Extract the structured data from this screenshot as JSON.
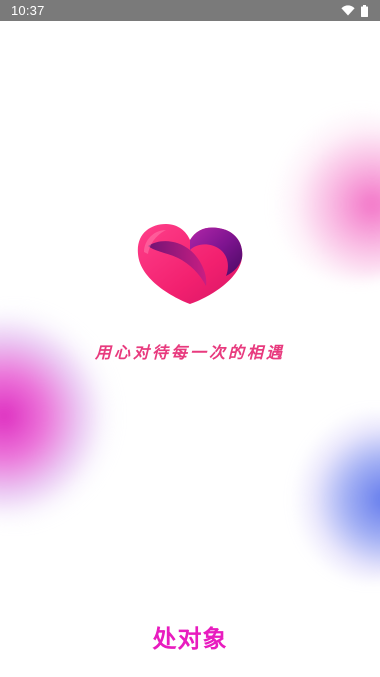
{
  "status_bar": {
    "time": "10:37",
    "icons": [
      "wifi-icon",
      "battery-icon"
    ]
  },
  "splash": {
    "tagline": "用心对待每一次的相遇",
    "app_name": "处对象",
    "logo": "heart-logo"
  },
  "colors": {
    "status_bar_bg": "#7a7a7a",
    "tagline": "#e83a7e",
    "app_name": "#e81cbf",
    "logo_pink": "#ff2d7a",
    "logo_purple": "#8e1aa0",
    "blob_pink": "#de2ec0",
    "blob_blue": "#6078ec"
  }
}
